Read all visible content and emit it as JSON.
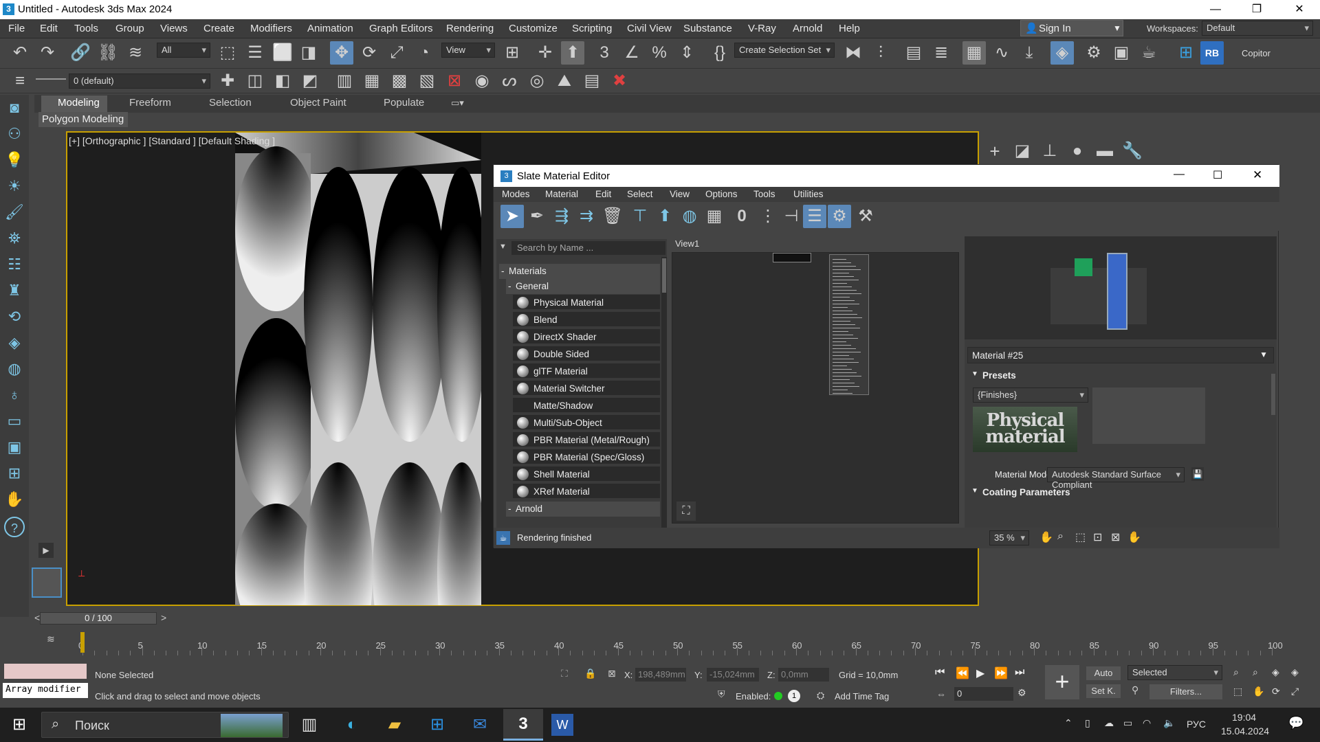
{
  "window": {
    "title": "Untitled - Autodesk 3ds Max 2024",
    "app_icon": "3"
  },
  "menu": [
    "File",
    "Edit",
    "Tools",
    "Group",
    "Views",
    "Create",
    "Modifiers",
    "Animation",
    "Graph Editors",
    "Rendering",
    "Customize",
    "Scripting",
    "Civil View",
    "Substance",
    "V-Ray",
    "Arnold",
    "Help"
  ],
  "signin": "Sign In",
  "workspaces": {
    "label": "Workspaces:",
    "value": "Default"
  },
  "toolbar": {
    "filter": "All",
    "view": "View",
    "selection_set": "Create Selection Set",
    "copitor": "Copitor",
    "layer": "0 (default)"
  },
  "ribbon": {
    "tabs": [
      "Modeling",
      "Freeform",
      "Selection",
      "Object Paint",
      "Populate"
    ],
    "sub": "Polygon Modeling"
  },
  "viewport": {
    "label": "[+] [Orthographic ] [Standard ] [Default Shading ]"
  },
  "sme": {
    "title": "Slate Material Editor",
    "menu": [
      "Modes",
      "Material",
      "Edit",
      "Select",
      "View",
      "Options",
      "Tools",
      "Utilities"
    ],
    "search_placeholder": "Search by Name ...",
    "root": "Materials",
    "general": "General",
    "materials": [
      "Physical Material",
      "Blend",
      "DirectX Shader",
      "Double Sided",
      "glTF Material",
      "Material Switcher",
      "Matte/Shadow",
      "Multi/Sub-Object",
      "PBR Material (Metal/Rough)",
      "PBR Material (Spec/Gloss)",
      "Shell Material",
      "XRef Material"
    ],
    "arnold": "Arnold",
    "view_tab": "View1",
    "material_name": "Material #25",
    "presets_label": "Presets",
    "presets_value": "{Finishes}",
    "logo_text": "Physical material",
    "material_mode_label": "Material Mode:",
    "material_mode_value": "Autodesk Standard Surface Compliant",
    "coating_label": "Coating Parameters",
    "status": "Rendering finished",
    "zoom": "35 %"
  },
  "timeline": {
    "position": "0 / 100",
    "ticks": [
      0,
      5,
      10,
      15,
      20,
      25,
      30,
      35,
      40,
      45,
      50,
      55,
      60,
      65,
      70,
      75,
      80,
      85,
      90,
      95,
      100
    ]
  },
  "status": {
    "selection": "None Selected",
    "hint": "Click and drag to select and move objects",
    "modifier": "Array modifier",
    "x_label": "X:",
    "x": "198,489mm",
    "y_label": "Y:",
    "y": "-15,024mm",
    "z_label": "Z:",
    "z": "0,0mm",
    "grid": "Grid = 10,0mm",
    "enabled": "Enabled:",
    "add_time_tag": "Add Time Tag",
    "auto": "Auto",
    "setk": "Set K.",
    "selected": "Selected",
    "filters": "Filters...",
    "frame": "0"
  },
  "taskbar": {
    "search": "Поиск",
    "lang": "РУС",
    "time": "19:04",
    "date": "15.04.2024"
  }
}
